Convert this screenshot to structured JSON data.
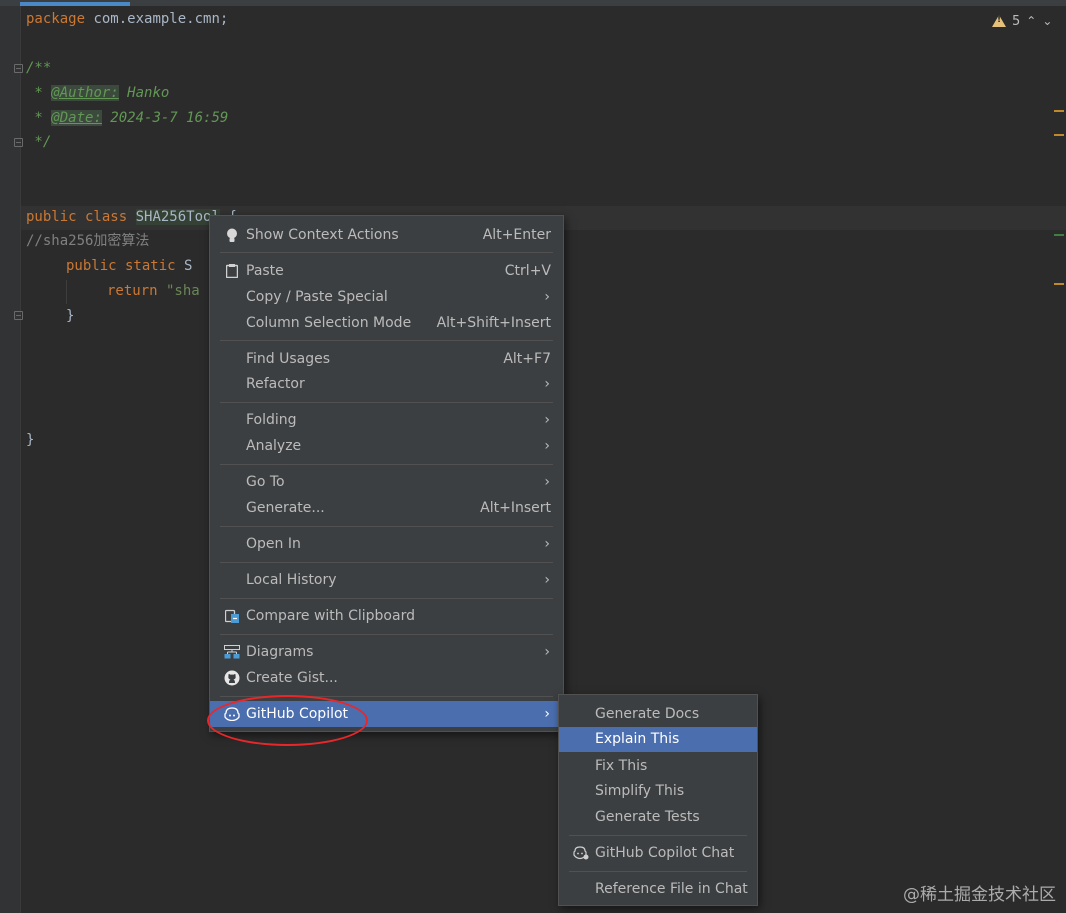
{
  "editor": {
    "inspection": {
      "count": "5",
      "warn_icon": "warning-triangle-icon"
    },
    "lines": {
      "package_kw": "package",
      "package_name": " com.example.cmn;",
      "doc_open": "/**",
      "doc_star1": " * ",
      "author_tag": "@Author:",
      "author_val": " Hanko",
      "doc_star2": " * ",
      "date_tag": "@Date:",
      "date_val": " 2024-3-7 16:59",
      "doc_close": " */",
      "class_kw": "public class",
      "class_name": "SHA256Tool",
      "class_brace": " {",
      "comment": "//sha256加密算法",
      "method_kw": "public static",
      "method_rest": " S",
      "return_kw": "return",
      "return_str": " \"sha",
      "close_inner": "}",
      "close_outer": "}"
    }
  },
  "context_menu": {
    "items": [
      {
        "label": "Show Context Actions",
        "shortcut": "Alt+Enter",
        "icon": "lightbulb-icon"
      },
      {
        "label": "Paste",
        "shortcut": "Ctrl+V",
        "icon": "clipboard-icon"
      },
      {
        "label": "Copy / Paste Special",
        "shortcut": "",
        "submenu": true
      },
      {
        "label": "Column Selection Mode",
        "shortcut": "Alt+Shift+Insert"
      },
      {
        "label": "Find Usages",
        "shortcut": "Alt+F7"
      },
      {
        "label": "Refactor",
        "submenu": true
      },
      {
        "label": "Folding",
        "submenu": true
      },
      {
        "label": "Analyze",
        "submenu": true
      },
      {
        "label": "Go To",
        "submenu": true
      },
      {
        "label": "Generate...",
        "shortcut": "Alt+Insert"
      },
      {
        "label": "Open In",
        "submenu": true
      },
      {
        "label": "Local History",
        "submenu": true
      },
      {
        "label": "Compare with Clipboard",
        "icon": "compare-icon"
      },
      {
        "label": "Diagrams",
        "submenu": true,
        "icon": "diagram-icon"
      },
      {
        "label": "Create Gist...",
        "icon": "github-icon"
      },
      {
        "label": "GitHub Copilot",
        "submenu": true,
        "icon": "copilot-icon",
        "selected": true
      }
    ]
  },
  "copilot_submenu": {
    "items": [
      {
        "label": "Generate Docs"
      },
      {
        "label": "Explain This",
        "selected": true
      },
      {
        "label": "Fix This"
      },
      {
        "label": "Simplify This"
      },
      {
        "label": "Generate Tests"
      },
      {
        "label": "GitHub Copilot Chat",
        "icon": "copilot-chat-icon"
      },
      {
        "label": "Reference File in Chat"
      }
    ]
  },
  "watermark": "@稀土掘金技术社区",
  "colors": {
    "selection": "#4b6eaf",
    "annotation": "#e8272b",
    "menu_bg": "#3c3f41",
    "editor_bg": "#2b2b2b"
  }
}
